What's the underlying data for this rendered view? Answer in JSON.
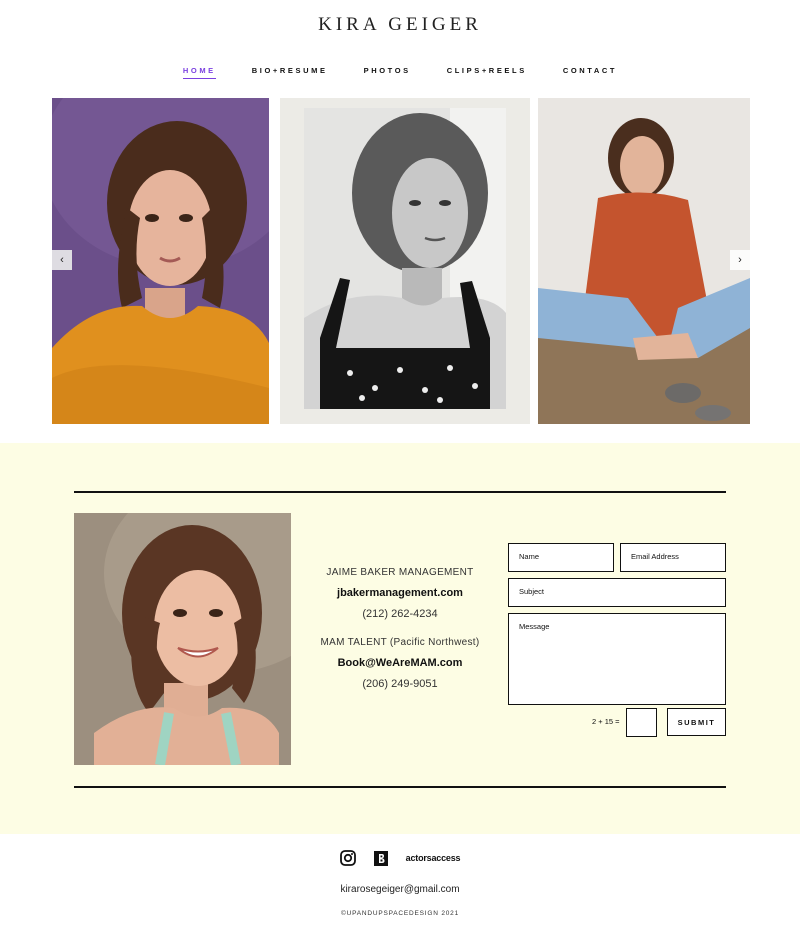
{
  "site": {
    "title": "KIRA GEIGER"
  },
  "nav": {
    "items": [
      {
        "label": "HOME",
        "active": true
      },
      {
        "label": "BIO+RESUME",
        "active": false
      },
      {
        "label": "PHOTOS",
        "active": false
      },
      {
        "label": "CLIPS+REELS",
        "active": false
      },
      {
        "label": "CONTACT",
        "active": false
      }
    ]
  },
  "gallery": {
    "prev_icon": "chevron-left-icon",
    "next_icon": "chevron-right-icon",
    "prev_glyph": "‹",
    "next_glyph": "›"
  },
  "contact": {
    "agencies": [
      {
        "name": "JAIME BAKER MANAGEMENT",
        "email": "jbakermanagement.com",
        "phone": "(212) 262-4234"
      },
      {
        "name": "MAM TALENT (Pacific Northwest)",
        "email": "Book@WeAreMAM.com",
        "phone": "(206) 249-9051"
      }
    ],
    "form": {
      "name_placeholder": "Name",
      "email_placeholder": "Email Address",
      "subject_placeholder": "Subject",
      "message_placeholder": "Message",
      "captcha_label": "2 + 15 =",
      "submit_label": "SUBMIT"
    }
  },
  "footer": {
    "social_icons": [
      "instagram-icon",
      "backstage-icon",
      "actors-access-icon"
    ],
    "actors_access_line1": "actors",
    "actors_access_line2": "access",
    "email": "kirarosegeiger@gmail.com",
    "copyright": "©UPANDUPSPACEDESIGN 2021"
  },
  "colors": {
    "accent": "#7a3fe0",
    "band_background": "#fdfde4"
  }
}
